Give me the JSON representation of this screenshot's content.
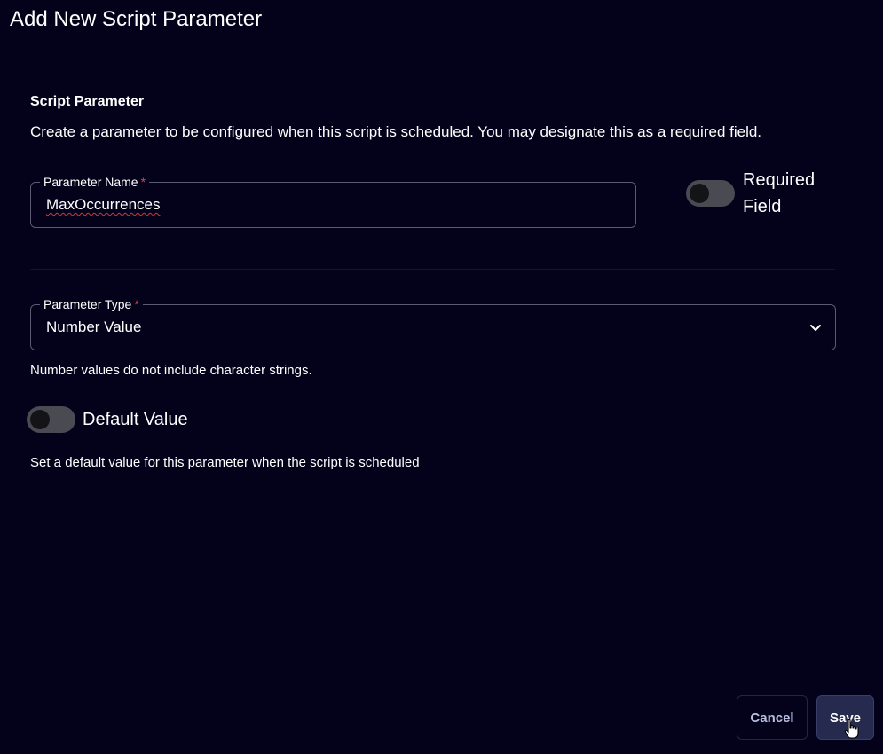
{
  "dialog": {
    "title": "Add New Script Parameter"
  },
  "section": {
    "heading": "Script Parameter",
    "description": "Create a parameter to be configured when this script is scheduled. You may designate this as a required field."
  },
  "parameter_name": {
    "label": "Parameter Name",
    "required_marker": "*",
    "value": "MaxOccurrences"
  },
  "required_field": {
    "label": "Required Field",
    "enabled": false
  },
  "parameter_type": {
    "label": "Parameter Type",
    "required_marker": "*",
    "selected": "Number Value",
    "helper_text": "Number values do not include character strings."
  },
  "default_value": {
    "label": "Default Value",
    "enabled": false,
    "helper_text": "Set a default value for this parameter when the script is scheduled"
  },
  "buttons": {
    "cancel_label": "Cancel",
    "save_label": "Save"
  },
  "colors": {
    "background": "#03021a",
    "field_border": "#5a5a72",
    "required_star": "#e0454b",
    "toggle_off_track": "#4a4a52",
    "save_button": "#262a4e",
    "cancel_text": "#b9bde0"
  },
  "icons": {
    "select_chevron": "chevron-down-icon",
    "pointer": "hand-pointer-icon"
  }
}
